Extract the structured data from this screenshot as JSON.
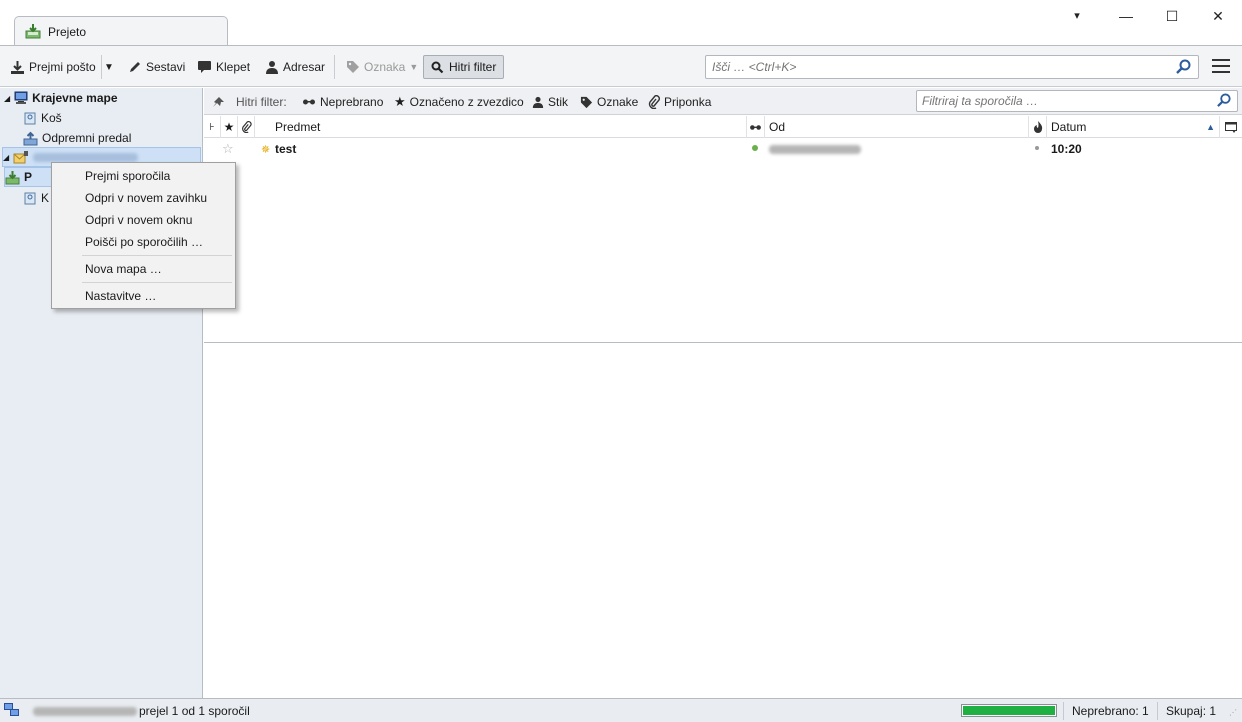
{
  "window": {
    "tab_title": "Prejeto",
    "controls": {
      "dropdown": "▾",
      "minimize": "—",
      "maximize": "☐",
      "close": "✕"
    }
  },
  "toolbar": {
    "get_mail_label": "Prejmi pošto",
    "compose_label": "Sestavi",
    "chat_label": "Klepet",
    "address_book_label": "Adresar",
    "tag_label": "Oznaka",
    "quick_filter_label": "Hitri filter",
    "search_placeholder": "Išči … <Ctrl+K>"
  },
  "folders": {
    "local_folders_label": "Krajevne mape",
    "trash_label": "Koš",
    "outbox_label": "Odpremni predal",
    "account_label": "primoz@isvancic.si",
    "inbox_label_partial": "P",
    "trash2_label_partial": "K"
  },
  "quick_filter": {
    "label": "Hitri filter:",
    "unread_label": "Neprebrano",
    "starred_label": "Označeno z zvezdico",
    "contact_label": "Stik",
    "tags_label": "Oznake",
    "attachment_label": "Priponka",
    "filter_placeholder": "Filtriraj ta sporočila …"
  },
  "thread_columns": {
    "subject": "Predmet",
    "from": "Od",
    "date": "Datum"
  },
  "messages": [
    {
      "subject": "test",
      "from": "Primož Isvančič",
      "date": "10:20"
    }
  ],
  "context_menu": {
    "items": [
      {
        "label": "Prejmi sporočila"
      },
      {
        "label": "Odpri v novem zavihku"
      },
      {
        "label": "Odpri v novem oknu"
      },
      {
        "label": "Poišči po sporočilih …"
      },
      {
        "label": "Nova mapa …"
      },
      {
        "label": "Nastavitve …"
      }
    ]
  },
  "statusbar": {
    "account_blurred": "primoz@isvancic.si",
    "status_text": "prejel 1 od 1 sporočil",
    "progress_fraction": 1.0,
    "unread_count": "Neprebrano: 1",
    "total_count": "Skupaj: 1"
  },
  "colors": {
    "progress_fill": "#1fb043",
    "folder_pane_bg": "#e8edf3",
    "selection_bg": "#cde0f6",
    "star_outline": "#b0b0b0",
    "new_indicator": "#e2a500",
    "status_dot": "#6ab04c"
  }
}
